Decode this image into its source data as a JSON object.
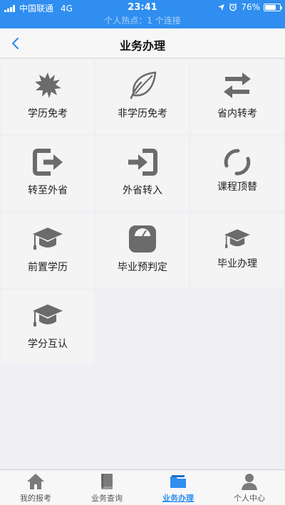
{
  "status_bar": {
    "carrier": "中国联通",
    "network": "4G",
    "time": "23:41",
    "battery_percent": "76%",
    "battery_level": 0.76,
    "hotspot_text": "个人热点：1 个连接"
  },
  "nav": {
    "title": "业务办理",
    "back_icon": "chevron-left-icon"
  },
  "services": [
    {
      "label": "学历免考",
      "icon": "starburst-icon"
    },
    {
      "label": "非学历免考",
      "icon": "leaf-icon"
    },
    {
      "label": "省内转考",
      "icon": "swap-arrows-icon"
    },
    {
      "label": "转至外省",
      "icon": "export-icon"
    },
    {
      "label": "外省转入",
      "icon": "import-icon"
    },
    {
      "label": "课程顶替",
      "icon": "refresh-circle-icon"
    },
    {
      "label": "前置学历",
      "icon": "graduation-cap-icon"
    },
    {
      "label": "毕业预判定",
      "icon": "scale-icon"
    },
    {
      "label": "毕业办理",
      "icon": "graduation-cap-icon"
    },
    {
      "label": "学分互认",
      "icon": "graduation-cap-icon"
    }
  ],
  "tabs": [
    {
      "label": "我的报考",
      "icon": "home-icon",
      "active": false
    },
    {
      "label": "业务查询",
      "icon": "book-icon",
      "active": false
    },
    {
      "label": "业务办理",
      "icon": "folder-icon",
      "active": true
    },
    {
      "label": "个人中心",
      "icon": "user-icon",
      "active": false
    }
  ],
  "colors": {
    "accent": "#2f8ef0",
    "icon_gray": "#6b6b6b",
    "tab_gray": "#7a7a7a"
  }
}
